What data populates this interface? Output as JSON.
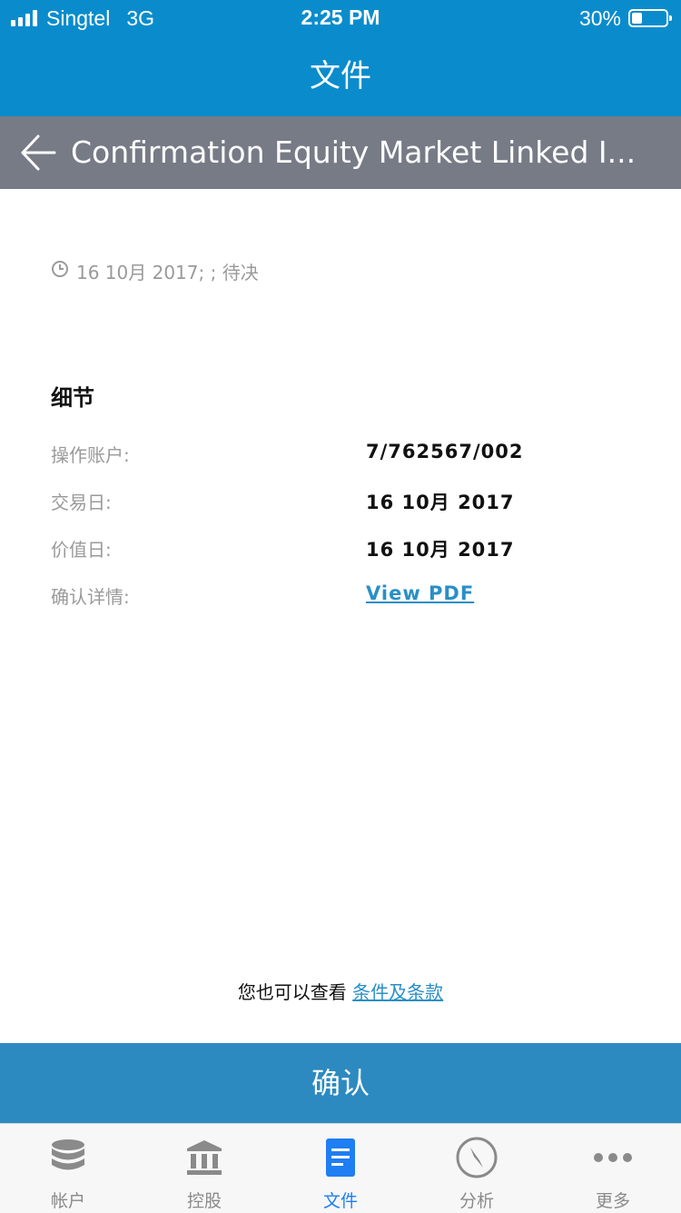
{
  "status_bar": {
    "carrier": "Singtel",
    "network": "3G",
    "time": "2:25 PM",
    "battery_percent": "30%",
    "battery_level": 0.3
  },
  "header": {
    "title": "文件"
  },
  "sub_header": {
    "back_icon": "back-arrow-icon",
    "document_title": "Confirmation Equity Market Linked I..."
  },
  "document": {
    "meta_icon": "clock-icon",
    "meta": "16 10月 2017; ; 待决",
    "section_title": "细节",
    "details": [
      {
        "label": "操作账户:",
        "value": "7/762567/002"
      },
      {
        "label": "交易日:",
        "value": "16 10月 2017"
      },
      {
        "label": "价值日:",
        "value": "16 10月 2017"
      },
      {
        "label": "确认详情:",
        "value": "View PDF"
      }
    ]
  },
  "terms": {
    "prefix": "您也可以查看 ",
    "link": "条件及条款"
  },
  "confirm_button": "确认",
  "colors": {
    "header_blue": "#0a8ccc",
    "subheader_gray": "#767b86",
    "button_blue": "#2c8ac0",
    "link_blue": "#2a8fc6",
    "active_tab": "#1f7ef2"
  },
  "tabs": [
    {
      "label": "帐户",
      "icon": "database-icon",
      "active": false
    },
    {
      "label": "控股",
      "icon": "bank-icon",
      "active": false
    },
    {
      "label": "文件",
      "icon": "document-icon",
      "active": true
    },
    {
      "label": "分析",
      "icon": "compass-icon",
      "active": false
    },
    {
      "label": "更多",
      "icon": "more-icon",
      "active": false
    }
  ]
}
